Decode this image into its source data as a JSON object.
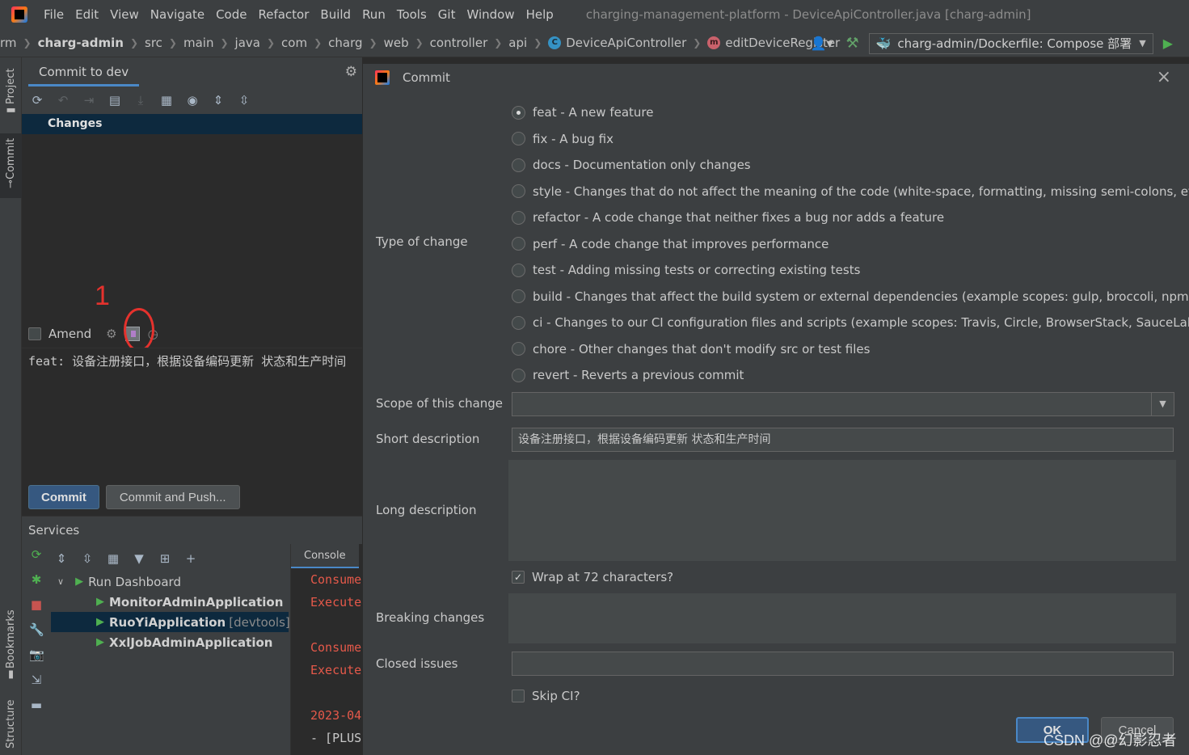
{
  "menubar": {
    "items": [
      "File",
      "Edit",
      "View",
      "Navigate",
      "Code",
      "Refactor",
      "Build",
      "Run",
      "Tools",
      "Git",
      "Window",
      "Help"
    ],
    "window_title": "charging-management-platform - DeviceApiController.java [charg-admin]"
  },
  "navbar": {
    "crumbs": [
      "rm",
      "charg-admin",
      "src",
      "main",
      "java",
      "com",
      "charg",
      "web",
      "controller",
      "api",
      "DeviceApiController",
      "editDeviceRegister"
    ],
    "class_icon_letter": "C",
    "method_icon_letter": "m",
    "run_config": "charg-admin/Dockerfile: Compose 部署"
  },
  "stripe": {
    "project": "Project",
    "commit": "Commit",
    "bookmarks": "Bookmarks",
    "structure": "Structure"
  },
  "commit_window": {
    "tab": "Commit to dev",
    "changes": "Changes",
    "amend": "Amend",
    "message": "feat: 设备注册接口，根据设备编码更新 状态和生产时间",
    "commit_button": "Commit",
    "commit_push_button": "Commit and Push...",
    "annotation_number": "1"
  },
  "services": {
    "title": "Services",
    "tree": {
      "root": "Run Dashboard",
      "apps": [
        {
          "name": "MonitorAdminApplication",
          "tag": ""
        },
        {
          "name": "RuoYiApplication",
          "tag": "[devtools]"
        },
        {
          "name": "XxlJobAdminApplication",
          "tag": ""
        }
      ]
    },
    "console_tab": "Console",
    "console_lines": [
      "Consume",
      "Execute",
      "",
      "Consume",
      "Execute",
      "",
      "2023-04-",
      "- [PLUS"
    ]
  },
  "dialog": {
    "title": "Commit",
    "type_label": "Type of change",
    "types": [
      "feat - A new feature",
      "fix - A bug fix",
      "docs - Documentation only changes",
      "style - Changes that do not affect the meaning of the code (white-space, formatting, missing semi-colons, etc)",
      "refactor - A code change that neither fixes a bug nor adds a feature",
      "perf - A code change that improves performance",
      "test - Adding missing tests or correcting existing tests",
      "build - Changes that affect the build system or external dependencies (example scopes: gulp, broccoli, npm)",
      "ci - Changes to our CI configuration files and scripts (example scopes: Travis, Circle, BrowserStack, SauceLabs)",
      "chore - Other changes that don't modify src or test files",
      "revert - Reverts a previous commit"
    ],
    "selected_type": 0,
    "scope_label": "Scope of this change",
    "scope_value": "",
    "short_label": "Short description",
    "short_value": "设备注册接口，根据设备编码更新 状态和生产时间",
    "long_label": "Long description",
    "wrap_label": "Wrap at 72 characters?",
    "wrap_checked": true,
    "breaking_label": "Breaking changes",
    "closed_label": "Closed issues",
    "skip_ci_label": "Skip CI?",
    "skip_ci_checked": false,
    "ok_button": "OK",
    "cancel_button": "Cancel"
  },
  "watermark": "CSDN @@幻影忍者",
  "colors": {
    "accent": "#4a88c7",
    "primary_button": "#365880",
    "run_green": "#4fb051",
    "annotation_red": "#e5322d"
  }
}
